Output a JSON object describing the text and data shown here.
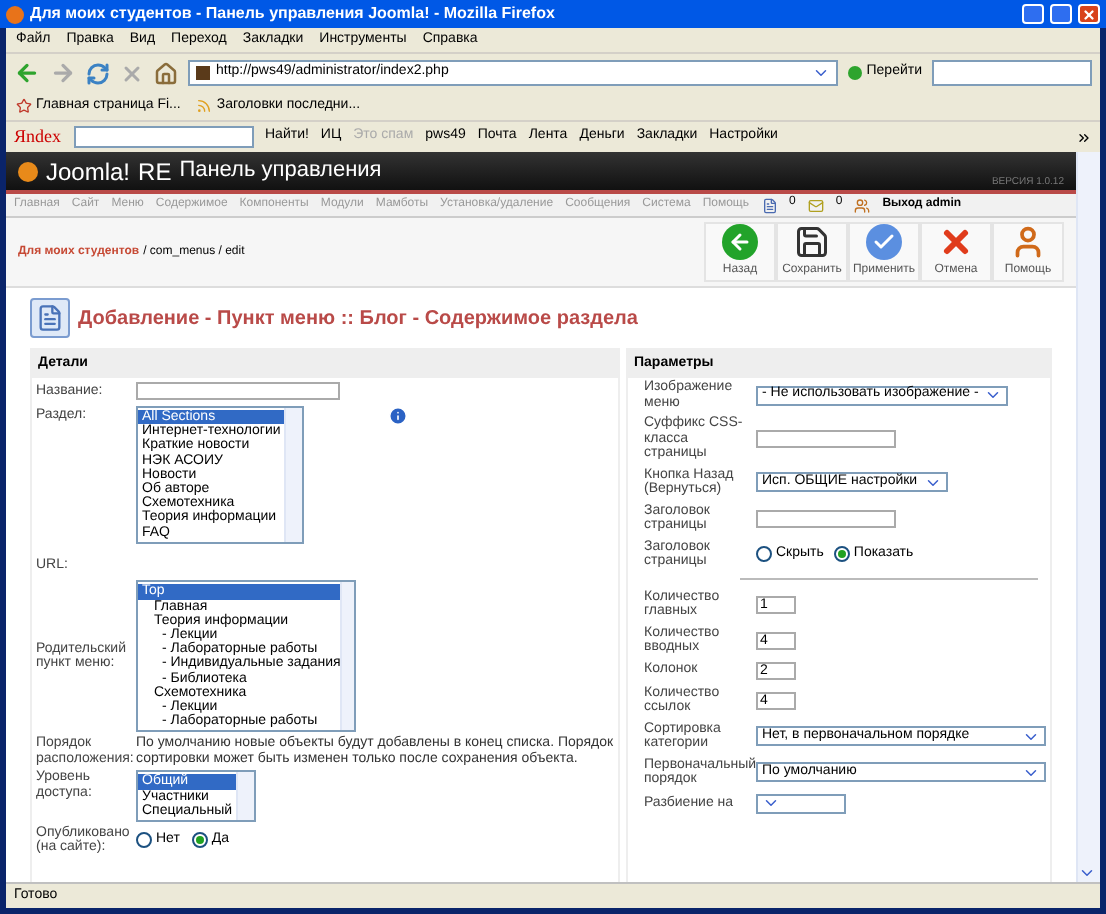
{
  "window": {
    "title": "Для моих студентов - Панель управления Joomla! - Mozilla Firefox"
  },
  "menu_bar": [
    "Файл",
    "Правка",
    "Вид",
    "Переход",
    "Закладки",
    "Инструменты",
    "Справка"
  ],
  "address_bar": {
    "url": "http://pws49/administrator/index2.php",
    "go_label": "Перейти"
  },
  "bookmarks": [
    "Главная страница Fi...",
    "Заголовки последни..."
  ],
  "yandex_toolbar": {
    "logo": "Яndex",
    "find_label": "Найти!",
    "items": [
      {
        "label": "ИЦ",
        "disabled": false
      },
      {
        "label": "Это спам",
        "disabled": true
      },
      {
        "label": "pws49",
        "disabled": false
      },
      {
        "label": "Почта",
        "disabled": false
      },
      {
        "label": "Лента",
        "disabled": false
      },
      {
        "label": "Деньги",
        "disabled": false
      },
      {
        "label": "Закладки",
        "disabled": false
      },
      {
        "label": "Настройки",
        "disabled": false
      }
    ]
  },
  "joomla_header": {
    "logo": "Joomla!",
    "edition": "RE",
    "title": "Панель управления",
    "version": "ВЕРСИЯ 1.0.12"
  },
  "admin_menu": {
    "items": [
      "Главная",
      "Сайт",
      "Меню",
      "Содержимое",
      "Компоненты",
      "Модули",
      "Мамботы",
      "Установка/удаление",
      "Сообщения",
      "Система",
      "Помощь"
    ],
    "messages_count": "0",
    "users_count": "0",
    "logout": "Выход admin"
  },
  "breadcrumb": {
    "site": "Для моих студентов",
    "path": "/ com_menus / edit"
  },
  "toolbar": [
    {
      "kind": "back",
      "label": "Назад"
    },
    {
      "kind": "save",
      "label": "Сохранить"
    },
    {
      "kind": "apply",
      "label": "Применить"
    },
    {
      "kind": "cancel",
      "label": "Отмена"
    },
    {
      "kind": "help",
      "label": "Помощь"
    }
  ],
  "heading": "Добавление - Пункт меню :: Блог - Содержимое раздела",
  "details": {
    "title": "Детали",
    "name_field": {
      "label": "Название:"
    },
    "section": {
      "label": "Раздел:",
      "options": [
        {
          "label": "All Sections",
          "selected": true
        },
        {
          "label": "Интернет-технологии",
          "selected": false
        },
        {
          "label": "Краткие новости",
          "selected": false
        },
        {
          "label": "НЭК АСОИУ",
          "selected": false
        },
        {
          "label": "Новости",
          "selected": false
        },
        {
          "label": "Об авторе",
          "selected": false
        },
        {
          "label": "Схемотехника",
          "selected": false
        },
        {
          "label": "Теория информации",
          "selected": false
        },
        {
          "label": "FAQ",
          "selected": false
        }
      ]
    },
    "url_label": "URL:",
    "parent_item": {
      "label": "Родительский пункт меню:",
      "options": [
        {
          "label": "Top",
          "selected": true,
          "children": [
            {
              "label": "Главная",
              "selected": false
            },
            {
              "label": "Теория информации",
              "selected": false,
              "children": [
                {
                  "label": "- Лекции",
                  "selected": false
                },
                {
                  "label": "- Лабораторные работы",
                  "selected": false
                },
                {
                  "label": "- Индивидуальные задания",
                  "selected": false
                },
                {
                  "label": "- Библиотека",
                  "selected": false
                }
              ]
            },
            {
              "label": "Схемотехника",
              "selected": false,
              "children": [
                {
                  "label": "- Лекции",
                  "selected": false
                },
                {
                  "label": "- Лабораторные работы",
                  "selected": false
                }
              ]
            }
          ]
        }
      ]
    },
    "ordering": {
      "label": "Порядок расположения:",
      "text": "По умолчанию новые объекты будут добавлены в конец списка. Порядок сортировки может быть изменен только после сохранения объекта."
    },
    "access": {
      "label": "Уровень доступа:",
      "options": [
        {
          "label": "Общий",
          "selected": true
        },
        {
          "label": "Участники",
          "selected": false
        },
        {
          "label": "Специальный",
          "selected": false
        }
      ]
    },
    "published": {
      "label": "Опубликовано (на сайте):",
      "options": [
        {
          "label": "Нет",
          "selected": false
        },
        {
          "label": "Да",
          "selected": true
        }
      ]
    }
  },
  "parameters": {
    "title": "Параметры",
    "rows": [
      {
        "kind": "select",
        "label": "Изображение меню",
        "value": "- Не использовать изображение -"
      },
      {
        "kind": "input",
        "label": "Суффикс CSS-класса страницы"
      },
      {
        "kind": "select",
        "label": "Кнопка Назад (Вернуться)",
        "value": "Исп. ОБЩИЕ настройки"
      },
      {
        "kind": "input",
        "label": "Заголовок страницы"
      },
      {
        "kind": "radio",
        "label": "Заголовок страницы",
        "options": [
          {
            "label": "Скрыть",
            "selected": false
          },
          {
            "label": "Показать",
            "selected": true
          }
        ]
      },
      {
        "kind": "separator"
      },
      {
        "kind": "number",
        "label": "Количество главных",
        "value": "1"
      },
      {
        "kind": "number",
        "label": "Количество вводных",
        "value": "4"
      },
      {
        "kind": "number",
        "label": "Колонок",
        "value": "2"
      },
      {
        "kind": "number",
        "label": "Количество ссылок",
        "value": "4"
      },
      {
        "kind": "wide_select",
        "label": "Сортировка категории",
        "value": "Нет, в первоначальном порядке"
      },
      {
        "kind": "wide_select",
        "label": "Первоначальный порядок",
        "value": "По умолчанию"
      },
      {
        "kind": "select",
        "label": "Разбиение на"
      }
    ]
  },
  "status_bar": "Готово"
}
